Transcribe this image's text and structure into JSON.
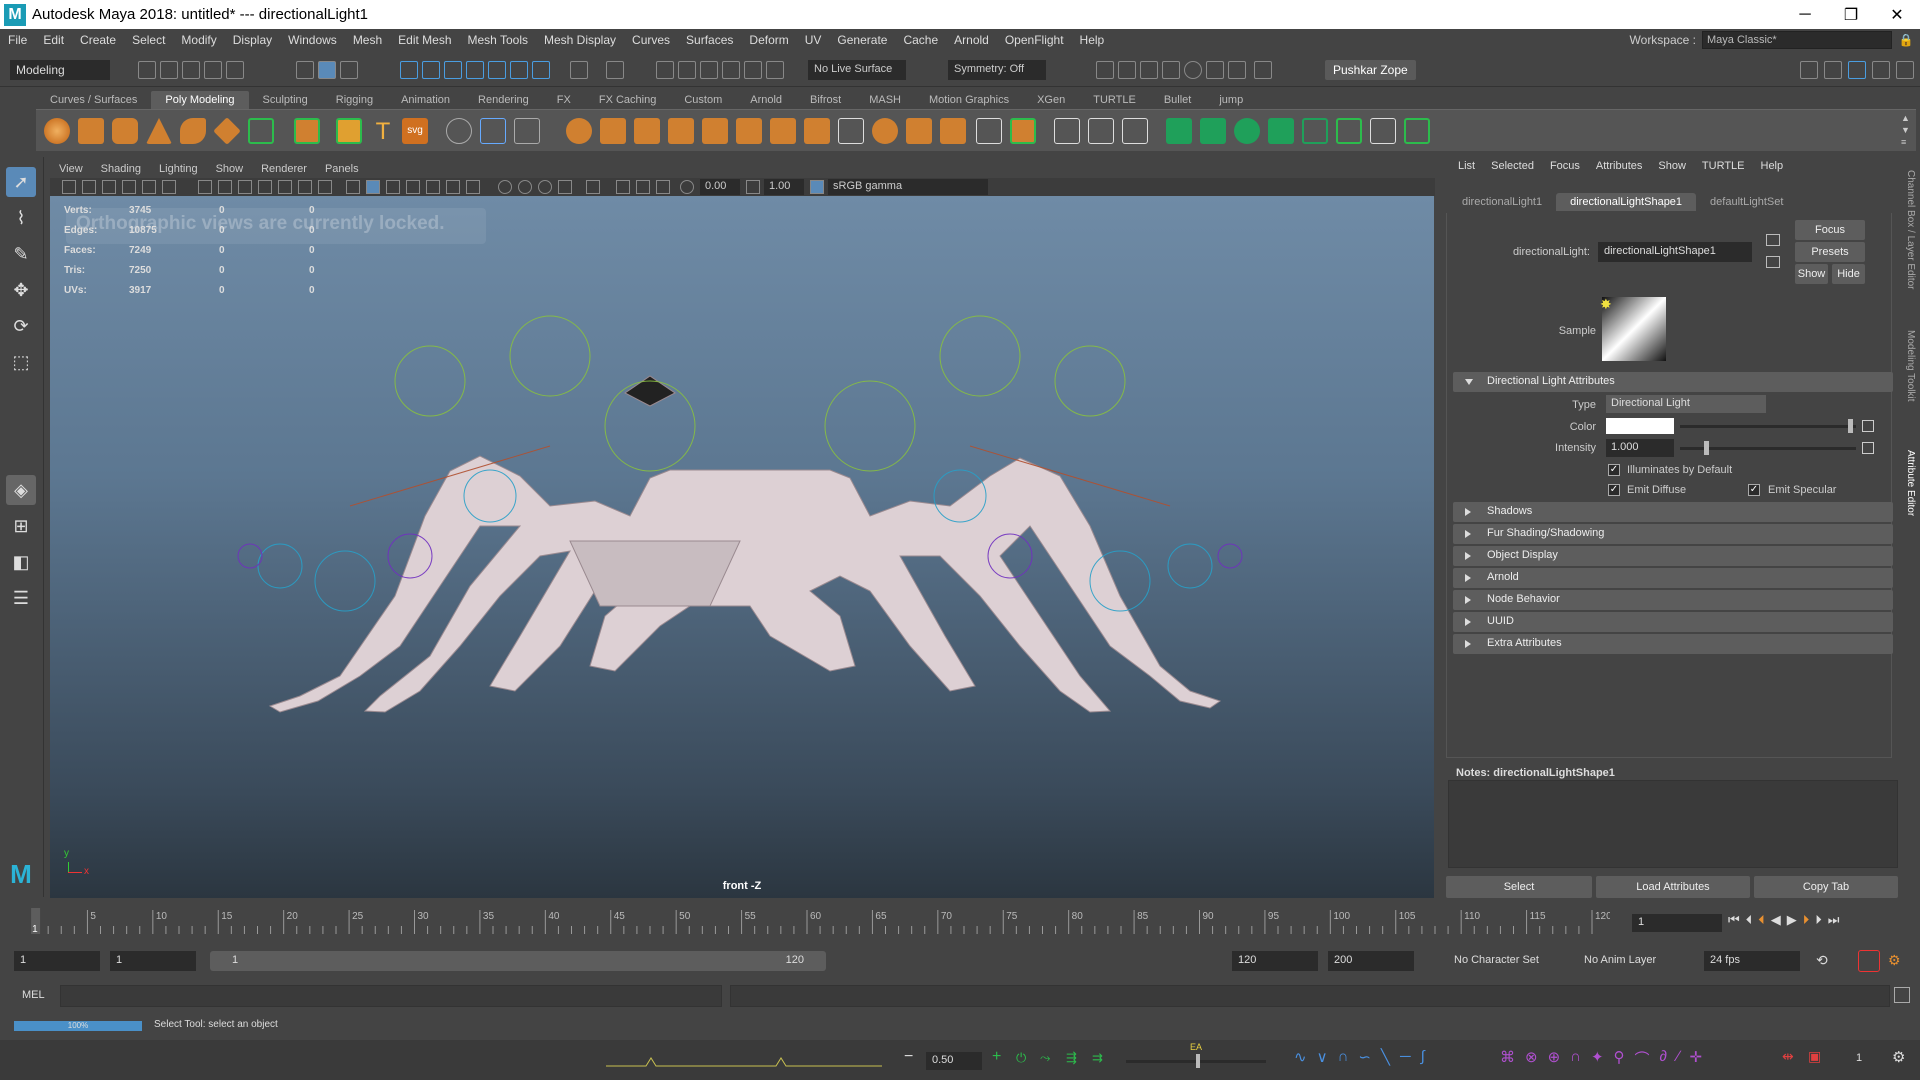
{
  "window": {
    "title": "Autodesk Maya 2018: untitled*   ---   directionalLight1",
    "minimize": "─",
    "maximize": "❐",
    "close": "✕",
    "logo": "M"
  },
  "menubar": [
    "File",
    "Edit",
    "Create",
    "Select",
    "Modify",
    "Display",
    "Windows",
    "Mesh",
    "Edit Mesh",
    "Mesh Tools",
    "Mesh Display",
    "Curves",
    "Surfaces",
    "Deform",
    "UV",
    "Generate",
    "Cache",
    "Arnold",
    "OpenFlight",
    "Help"
  ],
  "workspace": {
    "label": "Workspace :",
    "value": "Maya Classic*"
  },
  "statusline": {
    "mode": "Modeling",
    "live_surface": "No Live Surface",
    "symmetry": "Symmetry: Off",
    "user": "Pushkar Zope"
  },
  "shelf_tabs": [
    "Curves / Surfaces",
    "Poly Modeling",
    "Sculpting",
    "Rigging",
    "Animation",
    "Rendering",
    "FX",
    "FX Caching",
    "Custom",
    "Arnold",
    "Bifrost",
    "MASH",
    "Motion Graphics",
    "XGen",
    "TURTLE",
    "Bullet",
    "jump"
  ],
  "shelf_active": "Poly Modeling",
  "panel_menu": [
    "View",
    "Shading",
    "Lighting",
    "Show",
    "Renderer",
    "Panels"
  ],
  "panel_toolbar": {
    "val1": "0.00",
    "val2": "1.00",
    "colorspace": "sRGB gamma"
  },
  "hud": [
    {
      "label": "Verts:",
      "a": "3745",
      "b": "0",
      "c": "0"
    },
    {
      "label": "Edges:",
      "a": "10875",
      "b": "0",
      "c": "0"
    },
    {
      "label": "Faces:",
      "a": "7249",
      "b": "0",
      "c": "0"
    },
    {
      "label": "Tris:",
      "a": "7250",
      "b": "0",
      "c": "0"
    },
    {
      "label": "UVs:",
      "a": "3917",
      "b": "0",
      "c": "0"
    }
  ],
  "viewport_msg": "Orthographic views are currently locked.",
  "viewport_label": "front -Z",
  "axis": {
    "y": "y",
    "x": "x"
  },
  "attribute_editor": {
    "menu": [
      "List",
      "Selected",
      "Focus",
      "Attributes",
      "Show",
      "TURTLE",
      "Help"
    ],
    "tabs": [
      "directionalLight1",
      "directionalLightShape1",
      "defaultLightSet"
    ],
    "active_tab": "directionalLightShape1",
    "node_label": "directionalLight:",
    "node_value": "directionalLightShape1",
    "focus": "Focus",
    "presets": "Presets",
    "show": "Show",
    "hide": "Hide",
    "sample_label": "Sample",
    "section_open": "Directional Light Attributes",
    "type_label": "Type",
    "type_value": "Directional Light",
    "color_label": "Color",
    "color": "#ffffff",
    "intensity_label": "Intensity",
    "intensity_value": "1.000",
    "intensity_fraction": 0.15,
    "illum_default": "Illuminates by Default",
    "emit_diffuse": "Emit Diffuse",
    "emit_specular": "Emit Specular",
    "sections": [
      "Shadows",
      "Fur Shading/Shadowing",
      "Object Display",
      "Arnold",
      "Node Behavior",
      "UUID",
      "Extra Attributes"
    ],
    "notes": "Notes:  directionalLightShape1",
    "buttons": [
      "Select",
      "Load Attributes",
      "Copy Tab"
    ]
  },
  "side_tabs": [
    "Channel Box / Layer Editor",
    "Modeling Toolkit",
    "Attribute Editor"
  ],
  "timeline": {
    "ticks": [
      "5",
      "10",
      "15",
      "20",
      "25",
      "30",
      "35",
      "40",
      "45",
      "50",
      "55",
      "60",
      "65",
      "70",
      "75",
      "80",
      "85",
      "90",
      "95",
      "100",
      "105",
      "110",
      "115",
      "120"
    ],
    "current": "1",
    "current_field": "1"
  },
  "range": {
    "start": "1",
    "start2": "1",
    "slider_start": "1",
    "slider_end": "120",
    "end": "120",
    "end2": "200",
    "char_set": "No Character Set",
    "anim_layer": "No Anim Layer",
    "fps": "24 fps"
  },
  "cmd": {
    "lang": "MEL"
  },
  "help": {
    "progress": "100%",
    "text": "Select Tool: select an object"
  },
  "bottom": {
    "value": "0.50",
    "ea": "EA",
    "frame": "1"
  }
}
